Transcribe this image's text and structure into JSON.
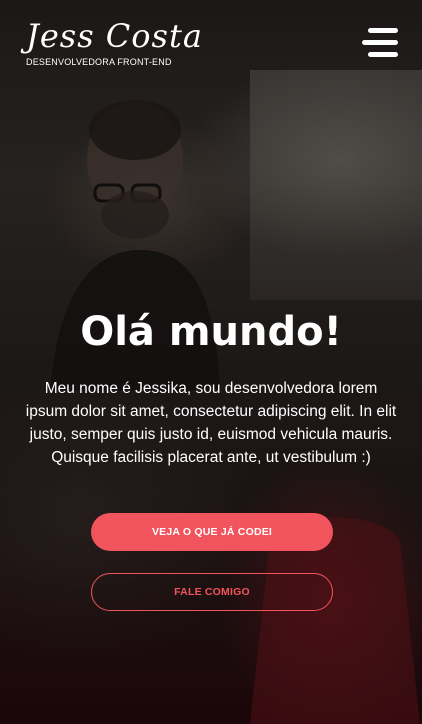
{
  "header": {
    "logo_name": "Jess Costa",
    "logo_tagline": "DESENVOLVEDORA FRONT-END",
    "menu_icon": "hamburger-menu-icon"
  },
  "hero": {
    "title": "Olá mundo!",
    "text": "Meu nome é Jessika, sou desenvolvedora lorem ipsum dolor sit amet, consectetur adipiscing elit. In elit justo, semper quis justo id, euismod vehicula mauris. Quisque facilisis placerat ante, ut vestibulum :)",
    "primary_button": "VEJA O QUE JÁ CODEI",
    "secondary_button": "FALE COMIGO"
  },
  "colors": {
    "accent": "#f1545c",
    "text": "#ffffff"
  }
}
